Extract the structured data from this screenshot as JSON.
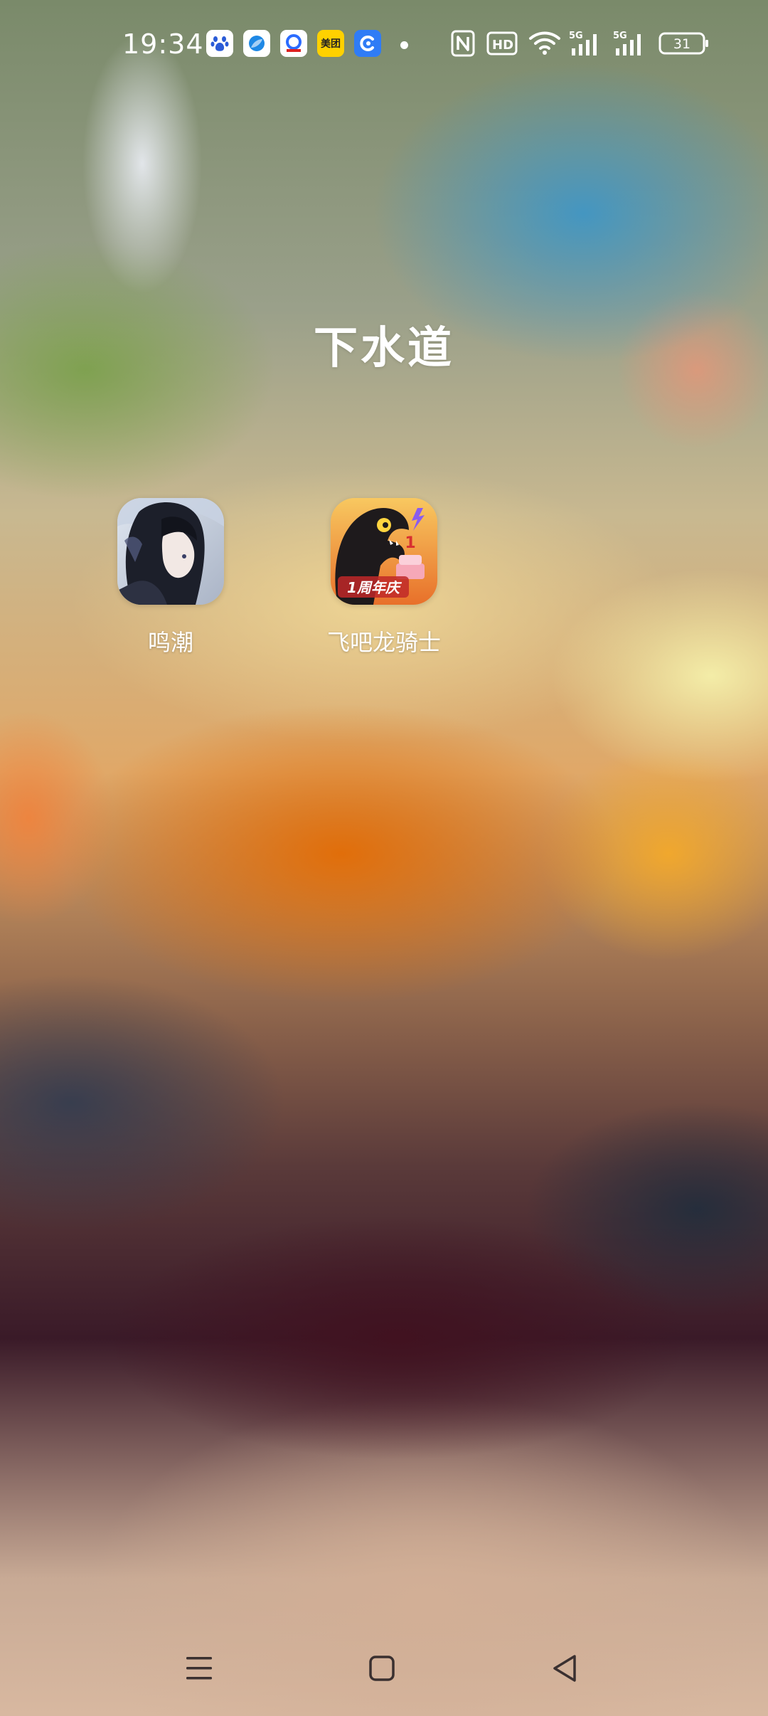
{
  "status_bar": {
    "time": "19:34",
    "notifications": [
      {
        "icon": "baidu-icon",
        "bg": "#ffffff",
        "fg": "#2a5bd7"
      },
      {
        "icon": "browser-icon",
        "bg": "#ffffff",
        "fg": "#1e88e5"
      },
      {
        "icon": "news-app-icon",
        "bg": "#ffffff",
        "fg": "#2b6cff"
      },
      {
        "icon": "meituan-icon",
        "text": "美团",
        "bg": "#ffd100",
        "fg": "#222222"
      },
      {
        "icon": "app-c-icon",
        "bg": "#2f7cf6",
        "fg": "#ffffff"
      }
    ],
    "network_1": "5G",
    "network_2": "5G",
    "hd_label": "HD",
    "battery": "31"
  },
  "folder": {
    "title": "下水道"
  },
  "apps": [
    {
      "label": "鸣潮",
      "icon": "wuthering-waves-app-icon"
    },
    {
      "label": "飞吧龙骑士",
      "icon": "dragon-rider-app-icon",
      "badge": "1周年庆"
    }
  ],
  "navigation": {
    "buttons": [
      "menu",
      "home",
      "back"
    ]
  },
  "colors": {
    "text": "#ffffff",
    "meituan": "#ffd100",
    "dragon_bg": "#f0a030"
  }
}
